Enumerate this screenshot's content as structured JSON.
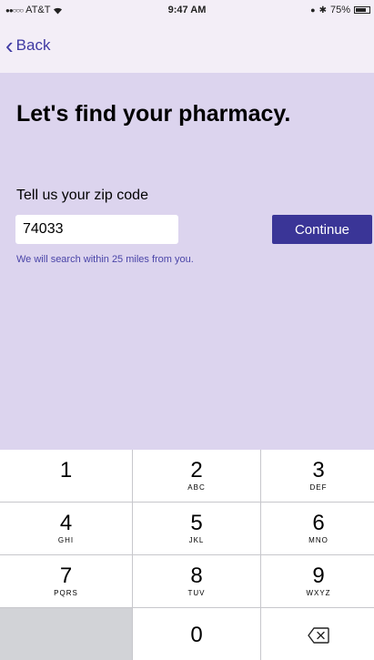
{
  "status_bar": {
    "carrier": "AT&T",
    "time": "9:47 AM",
    "battery": "75%"
  },
  "nav": {
    "back_label": "Back"
  },
  "main": {
    "title": "Let's find your pharmacy.",
    "zip_label": "Tell us your zip code",
    "zip_value": "74033",
    "continue_label": "Continue",
    "search_note": "We will search within 25 miles from you."
  },
  "keypad": {
    "keys": [
      {
        "digit": "1",
        "letters": ""
      },
      {
        "digit": "2",
        "letters": "ABC"
      },
      {
        "digit": "3",
        "letters": "DEF"
      },
      {
        "digit": "4",
        "letters": "GHI"
      },
      {
        "digit": "5",
        "letters": "JKL"
      },
      {
        "digit": "6",
        "letters": "MNO"
      },
      {
        "digit": "7",
        "letters": "PQRS"
      },
      {
        "digit": "8",
        "letters": "TUV"
      },
      {
        "digit": "9",
        "letters": "WXYZ"
      }
    ],
    "zero": {
      "digit": "0"
    },
    "delete_icon": "backspace-icon"
  },
  "colors": {
    "background": "#dcd4ee",
    "accent": "#3a3597",
    "link": "#3f3aa3",
    "note": "#4a45a8"
  }
}
